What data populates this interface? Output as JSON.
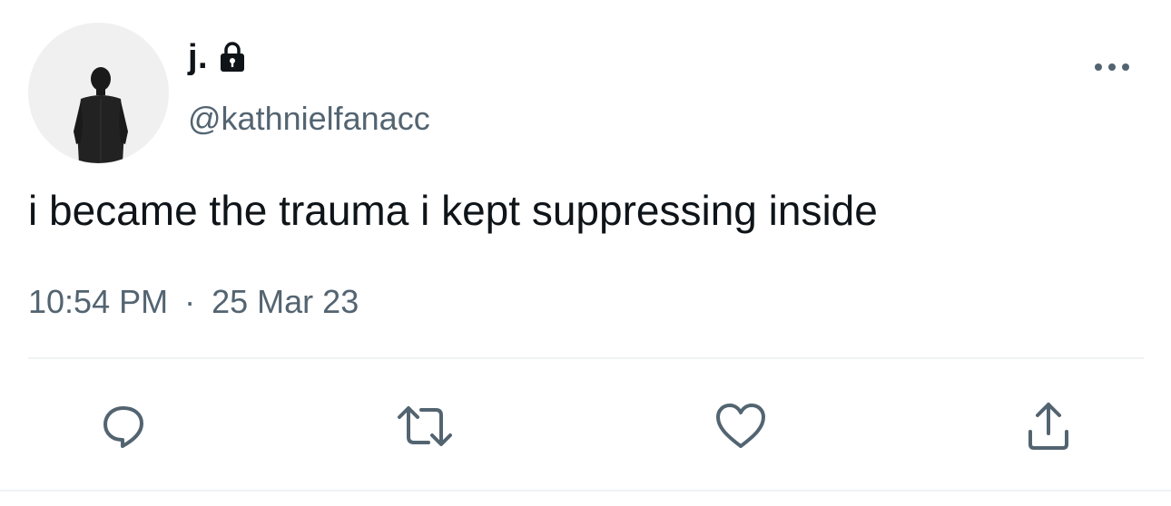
{
  "profile": {
    "display_name": "j.",
    "handle": "@kathnielfanacc",
    "protected_icon": "lock-icon",
    "avatar_icon": "person-silhouette"
  },
  "tweet": {
    "text": "i became the trauma i kept suppressing inside",
    "time": "10:54 PM",
    "separator": "·",
    "date": "25 Mar 23"
  },
  "actions": [
    {
      "name": "reply",
      "icon": "reply-icon"
    },
    {
      "name": "retweet",
      "icon": "retweet-icon"
    },
    {
      "name": "like",
      "icon": "heart-icon"
    },
    {
      "name": "share",
      "icon": "share-icon"
    }
  ],
  "colors": {
    "primary_text": "#0f1419",
    "secondary_text": "#536471",
    "divider": "#eff3f4",
    "icon": "#536471"
  }
}
